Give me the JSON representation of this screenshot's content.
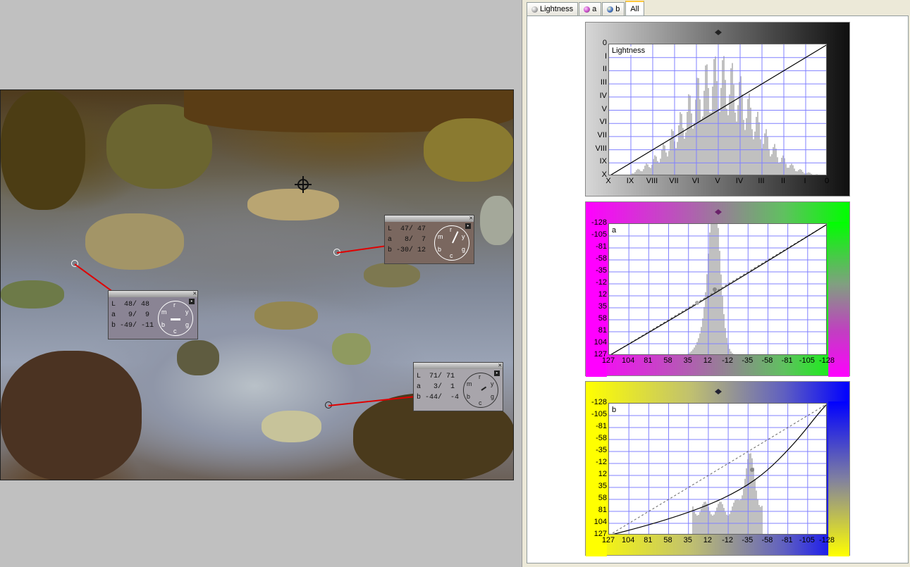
{
  "tabs": [
    {
      "label": "Lightness",
      "icon": "lightness-icon",
      "color": "#808080"
    },
    {
      "label": "a",
      "icon": "a-channel-icon",
      "color": "#c040c0"
    },
    {
      "label": "b",
      "icon": "b-channel-icon",
      "color": "#3060c0"
    },
    {
      "label": "All",
      "icon": "",
      "color": ""
    }
  ],
  "active_tab": "All",
  "samplers": [
    {
      "L": "L  48/ 48",
      "a": "a   9/  9",
      "b": "b -49/ -11",
      "dial_labels": [
        "r",
        "y",
        "g",
        "c",
        "b",
        "m"
      ]
    },
    {
      "L": "L  47/ 47",
      "a": "a   8/  7",
      "b": "b -30/ 12",
      "dial_labels": [
        "r",
        "y",
        "g",
        "c",
        "b",
        "m"
      ]
    },
    {
      "L": "L  71/ 71",
      "a": "a   3/  1",
      "b": "b -44/  -4",
      "dial_labels": [
        "r",
        "y",
        "g",
        "c",
        "b",
        "m"
      ]
    }
  ],
  "curves": {
    "lightness": {
      "label": "Lightness",
      "y_ticks": [
        "0",
        "I",
        "II",
        "III",
        "IV",
        "V",
        "VI",
        "VII",
        "VIII",
        "IX",
        "X"
      ],
      "x_ticks": [
        "X",
        "IX",
        "VIII",
        "VII",
        "VI",
        "V",
        "IV",
        "III",
        "II",
        "I",
        "0"
      ]
    },
    "a": {
      "label": "a",
      "y_ticks": [
        "-128",
        "-105",
        "-81",
        "-58",
        "-35",
        "-12",
        "12",
        "35",
        "58",
        "81",
        "104",
        "127"
      ],
      "x_ticks": [
        "127",
        "104",
        "81",
        "58",
        "35",
        "12",
        "-12",
        "-35",
        "-58",
        "-81",
        "-105",
        "-128"
      ]
    },
    "b": {
      "label": "b",
      "y_ticks": [
        "-128",
        "-105",
        "-81",
        "-58",
        "-35",
        "-12",
        "12",
        "35",
        "58",
        "81",
        "104",
        "127"
      ],
      "x_ticks": [
        "127",
        "104",
        "81",
        "58",
        "35",
        "12",
        "-12",
        "-35",
        "-58",
        "-81",
        "-105",
        "-128"
      ]
    }
  },
  "colors": {
    "lightness_bg_dark": "#000000",
    "lightness_bg_light": "#ffffff",
    "a_negative": "#ff00ff",
    "a_positive": "#00ff00",
    "b_negative": "#ffff00",
    "b_positive": "#0000ff",
    "grid": "#8080ff",
    "histogram": "#c0c0c0",
    "leader": "#e00000"
  }
}
